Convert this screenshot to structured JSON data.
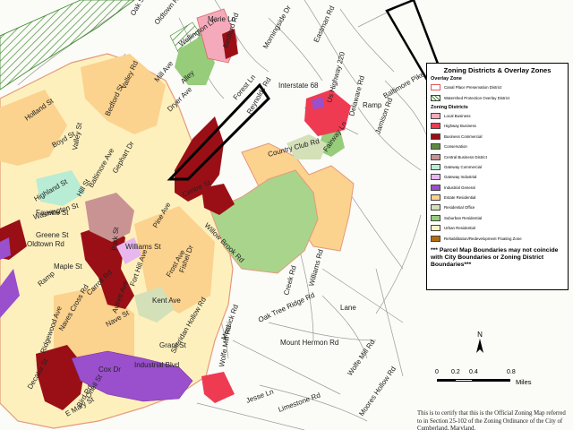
{
  "legend": {
    "title": "Zoning Districts & Overlay Zones",
    "overlay_heading": "Overlay Zone",
    "overlay_items": [
      {
        "label": "Canal Place Preservation District",
        "color": "#ffffff",
        "style": "outline-red"
      },
      {
        "label": "Watershed Protection Overlay District",
        "color": "#ffffff",
        "style": "hatch-green"
      }
    ],
    "districts_heading": "Zoning Districts",
    "districts": [
      {
        "label": "Local Business",
        "color": "#f4aabb"
      },
      {
        "label": "Highway Business",
        "color": "#ee3b52"
      },
      {
        "label": "Business Commercial",
        "color": "#9a0f16"
      },
      {
        "label": "Conservation",
        "color": "#5f8a3e"
      },
      {
        "label": "Central Business District",
        "color": "#c99393"
      },
      {
        "label": "Gateway Commercial",
        "color": "#b8ecd4"
      },
      {
        "label": "Gateway Industrial",
        "color": "#e8b7ee"
      },
      {
        "label": "Industrial General",
        "color": "#9a4fcc"
      },
      {
        "label": "Estate Residential",
        "color": "#fbd28e"
      },
      {
        "label": "Residential Office",
        "color": "#d4e0b8"
      },
      {
        "label": "Suburban Residential",
        "color": "#96cc7a"
      },
      {
        "label": "Urban Residential",
        "color": "#fdf4c4"
      },
      {
        "label": "Rehabilitation/Redevelopment Floating Zone",
        "color": "#b06c10"
      }
    ],
    "note": "*** Parcel Map Boundaries may not coincide with City Boundaries or Zoning District Boundaries***"
  },
  "scale": {
    "ticks": [
      "0",
      "0.2",
      "0.4",
      "0.8"
    ],
    "units": "Miles"
  },
  "north_label": "N",
  "certification": "This is to certify that this is the Official Zoning Map referred to in Section 25-102 of the Zoning Ordinance of the City of Cumberland, Maryland.",
  "roads": [
    "Oak St",
    "Oldtown Rd",
    "Marie Ln",
    "Bedford Rd",
    "Morningside Dr",
    "Eastman Rd",
    "Us Highway 220",
    "Wellington Ln",
    "Interstate 68",
    "Baltimore Pike",
    "Valley Rd",
    "Mill Ave",
    "Alley",
    "Dryer Ave",
    "Ramp",
    "Delaware Rd",
    "Jamison Rd",
    "Forest Ln",
    "Reynolds Rd",
    "Country Club Rd",
    "Fairway Ln",
    "Williams Rd",
    "Mount Hermon Rd",
    "Lane",
    "Creek Rd",
    "Oak Tree Ridge Rd",
    "Messick Rd",
    "Jesse Ln",
    "Limestone Rd",
    "Wolfe Mill Rd",
    "Willow Brook Rd",
    "Kent Ave",
    "Grant St",
    "Williams St",
    "Fort Hill Ave",
    "Holland St",
    "Boyd St",
    "Baltimore Ave",
    "Fayette St",
    "Greene St",
    "Pine Ave",
    "Ramp",
    "Park St",
    "Frost Ave",
    "Fishel Dr",
    "Cox Dr",
    "Industrial Blvd",
    "Sheridan Hollow Rd",
    "Highland St",
    "Ridgewood Ave",
    "Oldtown Rd",
    "Nave St",
    "Valley St",
    "Bedford St",
    "Hill St",
    "Gephart Dr",
    "Moores Hollow Rd",
    "Carroll Rd",
    "Oneil St",
    "Bird Rd",
    "E Mary St",
    "Decatur St",
    "Avirett Ave",
    "Naves Cross Rd",
    "Washington St",
    "Centre St",
    "Maple St",
    "Wolfe Mill Rd"
  ]
}
